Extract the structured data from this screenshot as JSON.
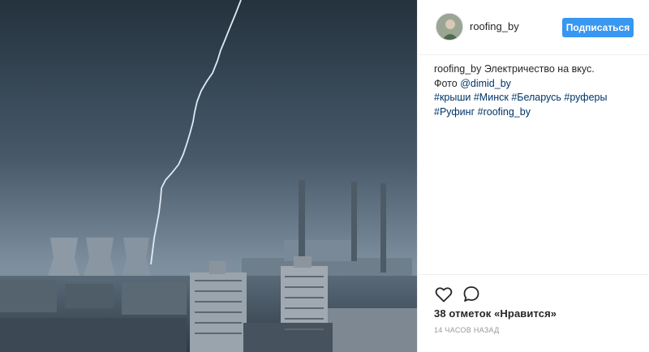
{
  "post": {
    "username": "roofing_by",
    "follow_label": "Подписаться",
    "caption": {
      "author": "roofing_by",
      "text": " Электричество на вкус.",
      "photo_prefix": "Фото ",
      "photo_mention": "@dimid_by",
      "hashtags_line1": [
        "#крыши",
        "#Минск",
        "#Беларусь",
        "#руферы"
      ],
      "hashtags_line2": [
        "#Руфинг",
        "#roofing_by"
      ]
    },
    "likes_text": "38 отметок «Нравится»",
    "timestamp": "14 ЧАСОВ НАЗАД",
    "icons": {
      "like": "heart-outline-icon",
      "comment": "speech-bubble-icon"
    }
  },
  "colors": {
    "accent": "#3897f0",
    "link": "#003569",
    "muted": "#999999"
  }
}
